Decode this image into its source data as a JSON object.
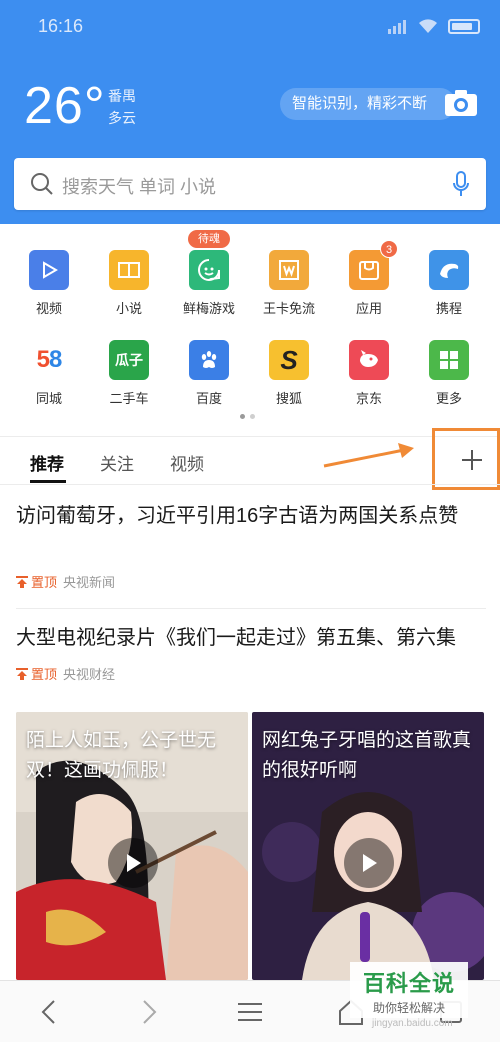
{
  "status": {
    "time": "16:16"
  },
  "weather": {
    "temp": "26°",
    "location": "番禺",
    "condition": "多云"
  },
  "smart_pill": "智能识别，精彩不断",
  "search": {
    "placeholder": "搜索天气 单词 小说"
  },
  "apps": [
    {
      "label": "视频",
      "color": "#4a7fe8",
      "icon": "play-icon"
    },
    {
      "label": "小说",
      "color": "#f7b52c",
      "icon": "book-icon"
    },
    {
      "label": "鲜梅游戏",
      "color": "#2db87a",
      "icon": "game-smile-icon"
    },
    {
      "label": "王卡免流",
      "color": "#f2a93b",
      "icon": "wangka-icon"
    },
    {
      "label": "应用",
      "color": "#f49a34",
      "icon": "app-store-icon"
    },
    {
      "label": "携程",
      "color": "#3f93e8",
      "icon": "dolphin-icon"
    },
    {
      "label": "同城",
      "color": "#ffffff",
      "icon": "58-logo-icon"
    },
    {
      "label": "二手车",
      "color": "#2aa54a",
      "icon": "guazi-icon"
    },
    {
      "label": "百度",
      "color": "#3b7fe6",
      "icon": "paw-icon"
    },
    {
      "label": "搜狐",
      "color": "#f7c02f",
      "icon": "sohu-icon"
    },
    {
      "label": "京东",
      "color": "#ee4a56",
      "icon": "jd-dog-icon"
    },
    {
      "label": "更多",
      "color": "#4cb84a",
      "icon": "grid-more-icon"
    }
  ],
  "badges": {
    "tag": "待魂",
    "count": "3"
  },
  "icon_text": {
    "fiftyeight": "58",
    "guazi": "瓜子"
  },
  "tabs": [
    "推荐",
    "关注",
    "视频"
  ],
  "news": [
    {
      "title": "访问葡萄牙，习近平引用16字古语为两国关系点赞",
      "pin": "置顶",
      "source": "央视新闻"
    },
    {
      "title": "大型电视纪录片《我们一起走过》第五集、第六集",
      "pin": "置顶",
      "source": "央视财经"
    }
  ],
  "videos": [
    {
      "title": "陌上人如玉，公子世无双！这画功佩服！"
    },
    {
      "title": "网红兔子牙唱的这首歌真的很好听啊"
    }
  ],
  "watermark": {
    "title": "百科全说",
    "subtitle": "助你轻松解决",
    "url": "jingyan.baidu.com"
  },
  "colors": {
    "header_blue": "#3d8ef0",
    "accent_orange": "#f08a36",
    "pin_orange": "#e8602b"
  }
}
